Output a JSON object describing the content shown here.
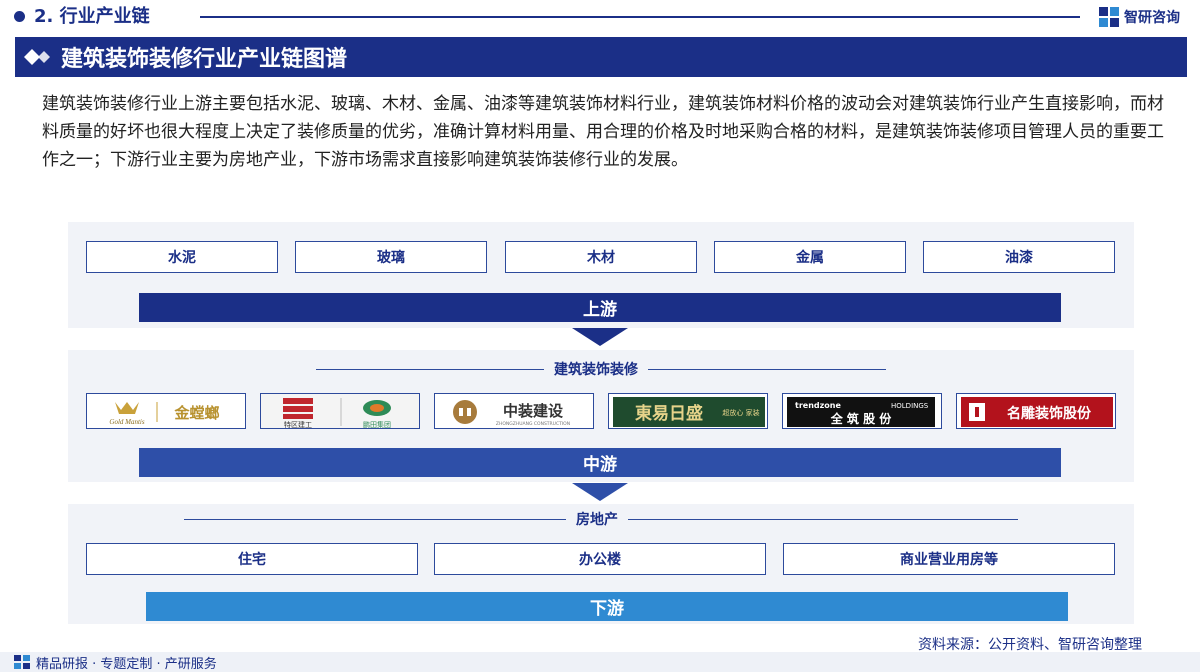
{
  "header": {
    "section_title": "2. 行业产业链",
    "brand_name": "智研咨询"
  },
  "banner": {
    "title": "建筑装饰装修行业产业链图谱"
  },
  "intro": {
    "text": "建筑装饰装修行业上游主要包括水泥、玻璃、木材、金属、油漆等建筑装饰材料行业，建筑装饰材料价格的波动会对建筑装饰行业产生直接影响，而材料质量的好坏也很大程度上决定了装修质量的优劣，准确计算材料用量、用合理的价格及时地采购合格的材料，是建筑装饰装修项目管理人员的重要工作之一；下游行业主要为房地产业，下游市场需求直接影响建筑装饰装修行业的发展。"
  },
  "upstream": {
    "items": [
      "水泥",
      "玻璃",
      "木材",
      "金属",
      "油漆"
    ],
    "label": "上游"
  },
  "midstream": {
    "title": "建筑装饰装修",
    "label": "中游",
    "logos": [
      {
        "name": "金螳螂",
        "sub": "Gold Mantis"
      },
      {
        "name_a": "特区建工",
        "name_b": "鹏田集团"
      },
      {
        "name": "中装建设",
        "sub": "ZHONGZHUANG CONSTRUCTION"
      },
      {
        "name": "東易日盛",
        "tag": "超放心 家装"
      },
      {
        "brand": "trendzone",
        "holdings": "HOLDINGS",
        "name": "全 筑 股 份"
      },
      {
        "name": "名雕装饰股份"
      }
    ]
  },
  "downstream": {
    "title": "房地产",
    "items": [
      "住宅",
      "办公楼",
      "商业营业用房等"
    ],
    "label": "下游"
  },
  "source": "资料来源：公开资料、智研咨询整理",
  "footer": "精品研报 · 专题定制 · 产研服务",
  "colors": {
    "primary": "#1b2f87",
    "mid": "#2e4fa8",
    "down": "#2f8ad2",
    "panel": "#f1f3f8"
  }
}
